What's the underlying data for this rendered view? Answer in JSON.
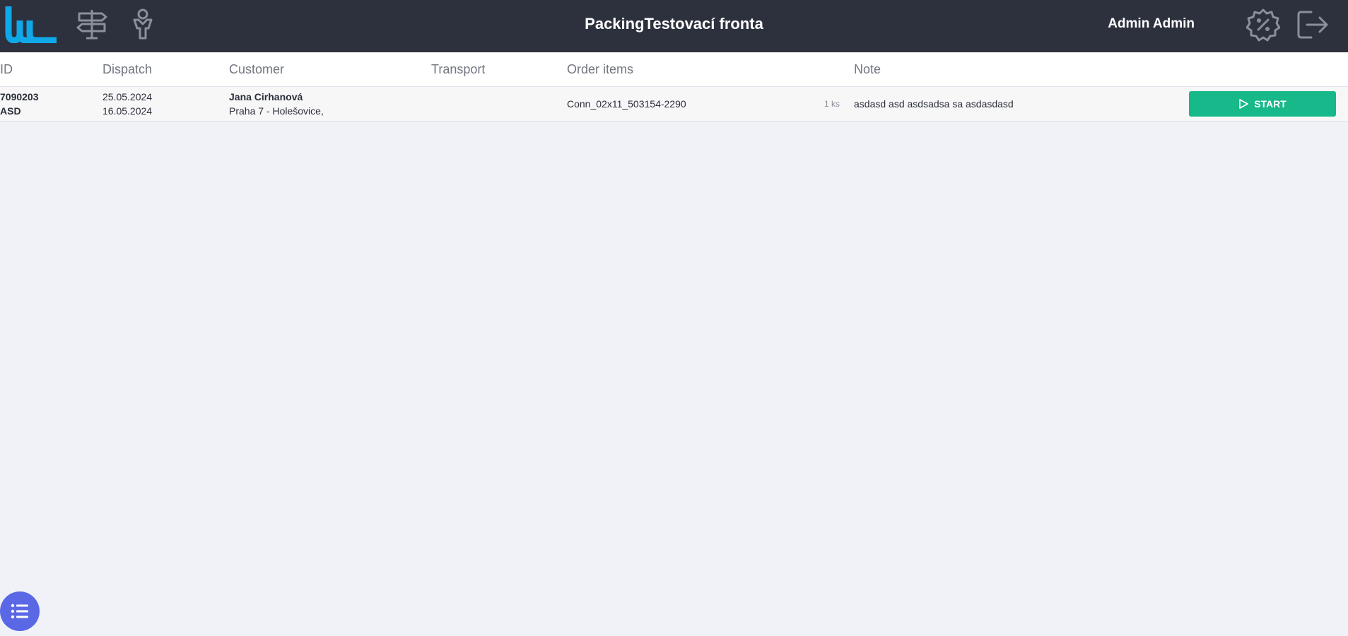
{
  "header": {
    "title": "PackingTestovací fronta",
    "user_name": "Admin Admin",
    "icons": [
      "logo-icon",
      "signpost-icon",
      "person-icon",
      "settings-icon",
      "logout-icon"
    ],
    "logo_color": "#0fa8e8",
    "background": "#2d313e"
  },
  "table": {
    "columns": {
      "id": "ID",
      "dispatch": "Dispatch",
      "customer": "Customer",
      "transport": "Transport",
      "order_items": "Order items",
      "note": "Note"
    },
    "rows": [
      {
        "id": "7090203",
        "code": "ASD",
        "dispatch_date": "25.05.2024",
        "order_date": "16.05.2024",
        "customer_name": "Jana Cirhanová",
        "customer_address": "Praha 7 - Holešovice,",
        "transport": "",
        "item": "Conn_02x11_503154-2290",
        "quantity": "1 ks",
        "note": "asdasd asd asdsadsa sa asdasdasd",
        "action_label": "START"
      }
    ]
  },
  "colors": {
    "start_button": "#17b88a",
    "fab": "#5a68e6"
  },
  "fab": {
    "icon": "list-icon"
  }
}
